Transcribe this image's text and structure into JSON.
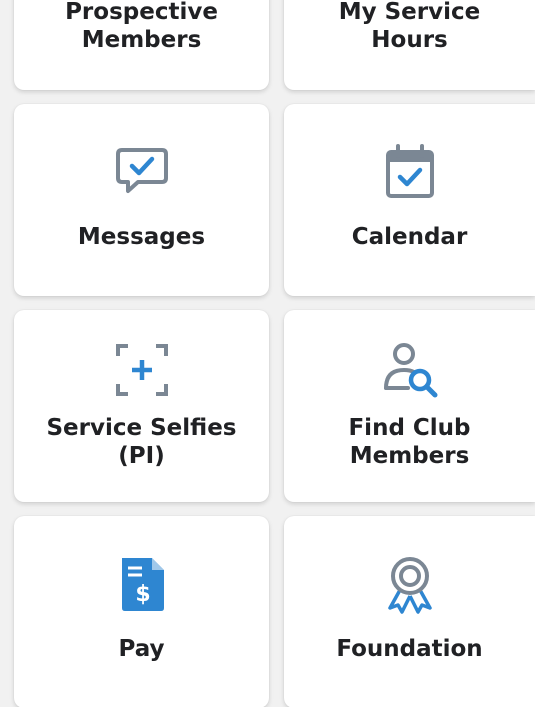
{
  "colors": {
    "icon_blue": "#2e86d1",
    "icon_gray": "#7b8794",
    "label": "#202124",
    "tile_bg": "#ffffff",
    "page_bg": "#f1f1f1"
  },
  "tiles": [
    {
      "line1": "Prospective",
      "line2": "Members",
      "icon": null
    },
    {
      "line1": "My Service",
      "line2": "Hours",
      "icon": null
    },
    {
      "line1": "Messages",
      "icon": "chat-check-icon"
    },
    {
      "line1": "Calendar",
      "icon": "calendar-check-icon"
    },
    {
      "line1": "Service Selfies",
      "line2": "(PI)",
      "icon": "camera-frame-plus-icon"
    },
    {
      "line1": "Find Club",
      "line2": "Members",
      "icon": "person-search-icon"
    },
    {
      "line1": "Pay",
      "icon": "invoice-dollar-icon"
    },
    {
      "line1": "Foundation",
      "icon": "award-ribbon-icon"
    }
  ]
}
